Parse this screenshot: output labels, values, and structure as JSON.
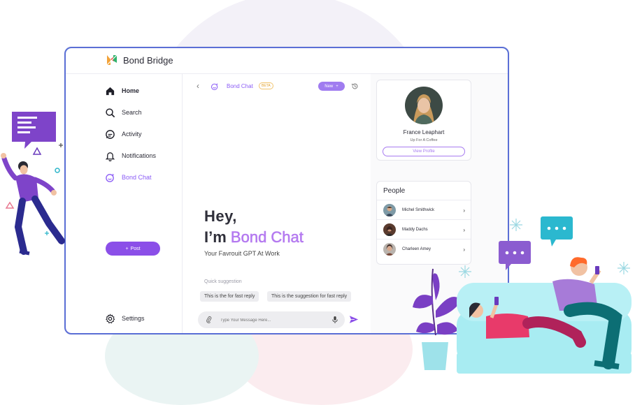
{
  "app": {
    "brand": "Bond Bridge"
  },
  "sidebar": {
    "items": [
      {
        "label": "Home",
        "icon": "home-icon"
      },
      {
        "label": "Search",
        "icon": "search-icon"
      },
      {
        "label": "Activity",
        "icon": "activity-icon"
      },
      {
        "label": "Notifications",
        "icon": "bell-icon"
      },
      {
        "label": "Bond Chat",
        "icon": "bond-chat-icon"
      }
    ],
    "post_label": "Post",
    "settings_label": "Settings"
  },
  "chat": {
    "name": "Bond Chat",
    "badge": "BETA",
    "new_label": "New",
    "greeting_line1": "Hey,",
    "greeting_prefix": "I’m",
    "greeting_name": "Bond Chat",
    "tagline": "Your Favrouit GPT At Work",
    "quick_label": "Quick suggestion",
    "suggestions": [
      "This is the for fast reply",
      "This is the suggestion for fast reply"
    ],
    "input_placeholder": "Type Your Message Here..."
  },
  "profile": {
    "name": "France Leaphart",
    "status": "Up For A Coffee",
    "view_label": "View Profile"
  },
  "people": {
    "title": "People",
    "items": [
      {
        "name": "Michel Smithwick"
      },
      {
        "name": "Maddy Dachs"
      },
      {
        "name": "Charleen Amey"
      }
    ]
  },
  "colors": {
    "accent": "#8b4fe8",
    "border_top": "#4fa3d9",
    "border_bottom": "#a34fd6"
  }
}
